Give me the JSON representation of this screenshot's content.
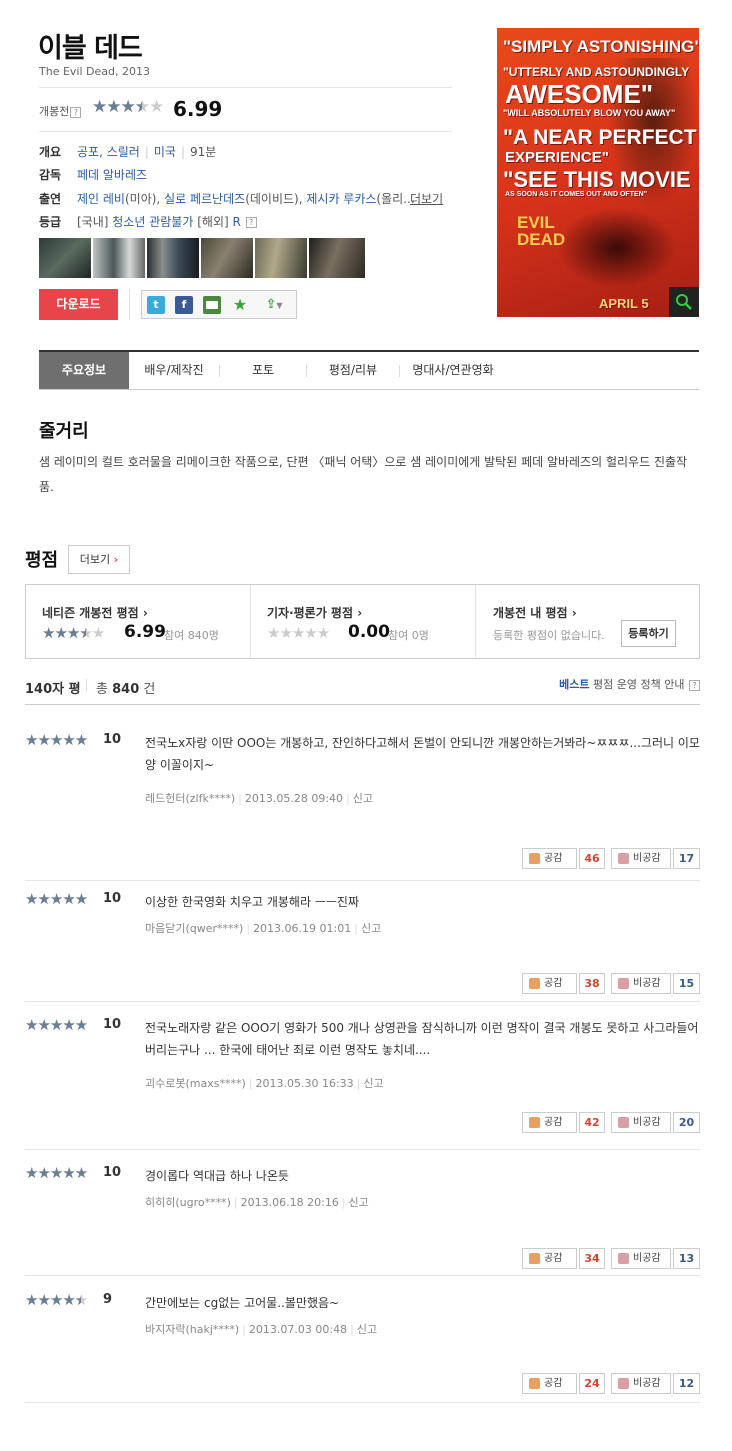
{
  "movie": {
    "title": "이블 데드",
    "original": "The Evil Dead, 2013",
    "pre_label": "개봉전",
    "help": "?",
    "pre_score": "6.99",
    "pre_stars": 0.7
  },
  "info": {
    "summary_key": "개요",
    "genres": "공포, 스릴러",
    "country": "미국",
    "runtime": "91분",
    "director_key": "감독",
    "director": "페데 알바레즈",
    "cast_key": "출연",
    "cast1": "제인 레비",
    "role1": "(미아),",
    "cast2": "실로 페르난데즈",
    "role2": "(데이비드),",
    "cast3": "제시카 루카스",
    "role3": "(올리...",
    "more_cast": "더보기",
    "grade_key": "등급",
    "grade_dom_label": "[국내]",
    "grade_dom": "청소년 관람불가",
    "grade_int_label": "[해외]",
    "grade_int": "R"
  },
  "actions": {
    "download": "다운로드",
    "share_twitter": "t",
    "share_facebook": "f"
  },
  "poster": {
    "line1": "\"SIMPLY ASTONISHING\"",
    "line2": "\"UTTERLY AND ASTOUNDINGLY",
    "line3": "AWESOME\"",
    "line4": "\"WILL ABSOLUTELY BLOW YOU AWAY\"",
    "line5": "\"A NEAR PERFECT",
    "line6": "EXPERIENCE\"",
    "line7": "\"SEE THIS MOVIE",
    "line8": "AS SOON AS IT COMES OUT AND OFTEN\"",
    "logo1": "EVIL",
    "logo2": "DEAD",
    "date": "APRIL 5"
  },
  "tabs": [
    "주요정보",
    "배우/제작진",
    "포토",
    "평점/리뷰",
    "명대사/연관영화"
  ],
  "synopsis": {
    "title": "줄거리",
    "text": "샘 레이미의 컬트 호러물을 리메이크한 작품으로, 단편 〈패닉 어택〉으로 샘 레이미에게 발탁된 페데 알바레즈의 헐리우드 진출작품."
  },
  "ratings": {
    "title": "평점",
    "more": "더보기",
    "netizen_title": "네티즌 개봉전 평점 ›",
    "netizen_score": "6.99",
    "netizen_count": "참여 840명",
    "netizen_stars": 0.7,
    "critic_title": "기자·평론가 평점 ›",
    "critic_score": "0.00",
    "critic_count": "참여 0명",
    "critic_stars": 0,
    "mine_title": "개봉전 내 평점 ›",
    "mine_note": "등록한 평점이 없습니다.",
    "register": "등록하기"
  },
  "list_header": {
    "label": "140자 평",
    "total_prefix": "총",
    "total": "840",
    "total_suffix": "건",
    "best": "베스트",
    "policy": "평점 운영 정책 안내"
  },
  "vote_labels": {
    "like": "공감",
    "dislike": "비공감",
    "report": "신고"
  },
  "reviews": [
    {
      "score": "10",
      "stars": 1.0,
      "text": "전국노x자랑 이딴 OOO는 개봉하고, 잔인하다고해서 돈벌이 안되니깐 개봉안하는거봐라~ㅉㅉㅉ...그러니 이모양 이꼴이지~",
      "author": "레드헌터(zlfk****)",
      "date": "2013.05.28 09:40",
      "likes": "46",
      "dislikes": "17"
    },
    {
      "score": "10",
      "stars": 1.0,
      "text": "이상한 한국영화 치우고 개봉해라 ㅡㅡ진짜",
      "author": "마음닫기(qwer****)",
      "date": "2013.06.19 01:01",
      "likes": "38",
      "dislikes": "15"
    },
    {
      "score": "10",
      "stars": 1.0,
      "text": "전국노래자랑 같은 OOO기 영화가 500 개나 상영관을 잠식하니까 이런 명작이 결국 개봉도 못하고 사그라들어버리는구나 ... 한국에 태어난 죄로 이런 명작도 놓치네....",
      "author": "괴수로봇(maxs****)",
      "date": "2013.05.30 16:33",
      "likes": "42",
      "dislikes": "20"
    },
    {
      "score": "10",
      "stars": 1.0,
      "text": "경이롭다 역대급 하나 나온듯",
      "author": "히히히(ugro****)",
      "date": "2013.06.18 20:16",
      "likes": "34",
      "dislikes": "13"
    },
    {
      "score": "9",
      "stars": 0.9,
      "text": "간만에보는 cg없는 고어물..볼만했음~",
      "author": "바지자락(hakj****)",
      "date": "2013.07.03 00:48",
      "likes": "24",
      "dislikes": "12"
    }
  ],
  "colors": {
    "accent": "#e8454a",
    "star": "#6b7e95",
    "like": "#d8442c",
    "dislike": "#3a5a8a",
    "link": "#2a5ca8"
  },
  "icons": {
    "twitter": "twitter-icon",
    "facebook": "facebook-icon",
    "blog": "blog-icon",
    "bookmark": "star-icon",
    "share": "share-icon",
    "zoom": "search-icon"
  }
}
